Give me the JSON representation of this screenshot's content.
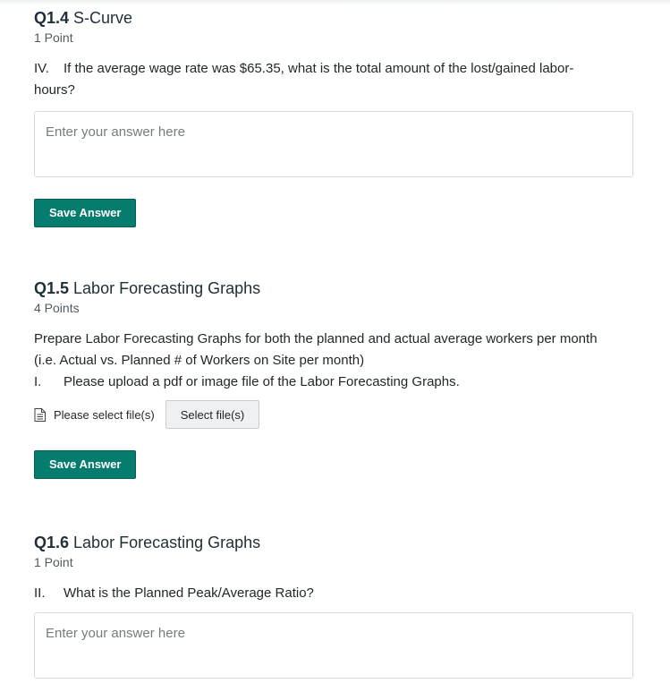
{
  "questions": [
    {
      "number": "Q1.4",
      "title": "S-Curve",
      "points": "1 Point",
      "prompt_roman": "IV.",
      "prompt_text": "If the average wage rate was $65.35, what is the total amount of the lost/gained labor-hours?",
      "answer_placeholder": "Enter your answer here",
      "save_label": "Save Answer"
    },
    {
      "number": "Q1.5",
      "title": "Labor Forecasting Graphs",
      "points": "4 Points",
      "description_line1": "Prepare Labor Forecasting Graphs for both the planned and actual average workers per month",
      "description_line2": "(i.e. Actual vs. Planned # of Workers on Site per month)",
      "prompt_roman": "I.",
      "prompt_text": "Please upload a pdf or image file of the Labor Forecasting Graphs.",
      "upload_label": "Please select file(s)",
      "select_files_label": "Select file(s)",
      "save_label": "Save Answer"
    },
    {
      "number": "Q1.6",
      "title": "Labor Forecasting Graphs",
      "points": "1 Point",
      "prompt_roman": "II.",
      "prompt_text": "What is the Planned Peak/Average Ratio?",
      "answer_placeholder": "Enter your answer here"
    }
  ],
  "icons": {
    "file": "file-icon"
  },
  "colors": {
    "save_button_bg": "#067c6e",
    "title_text": "#1f2f36",
    "border": "#d6dadd"
  }
}
